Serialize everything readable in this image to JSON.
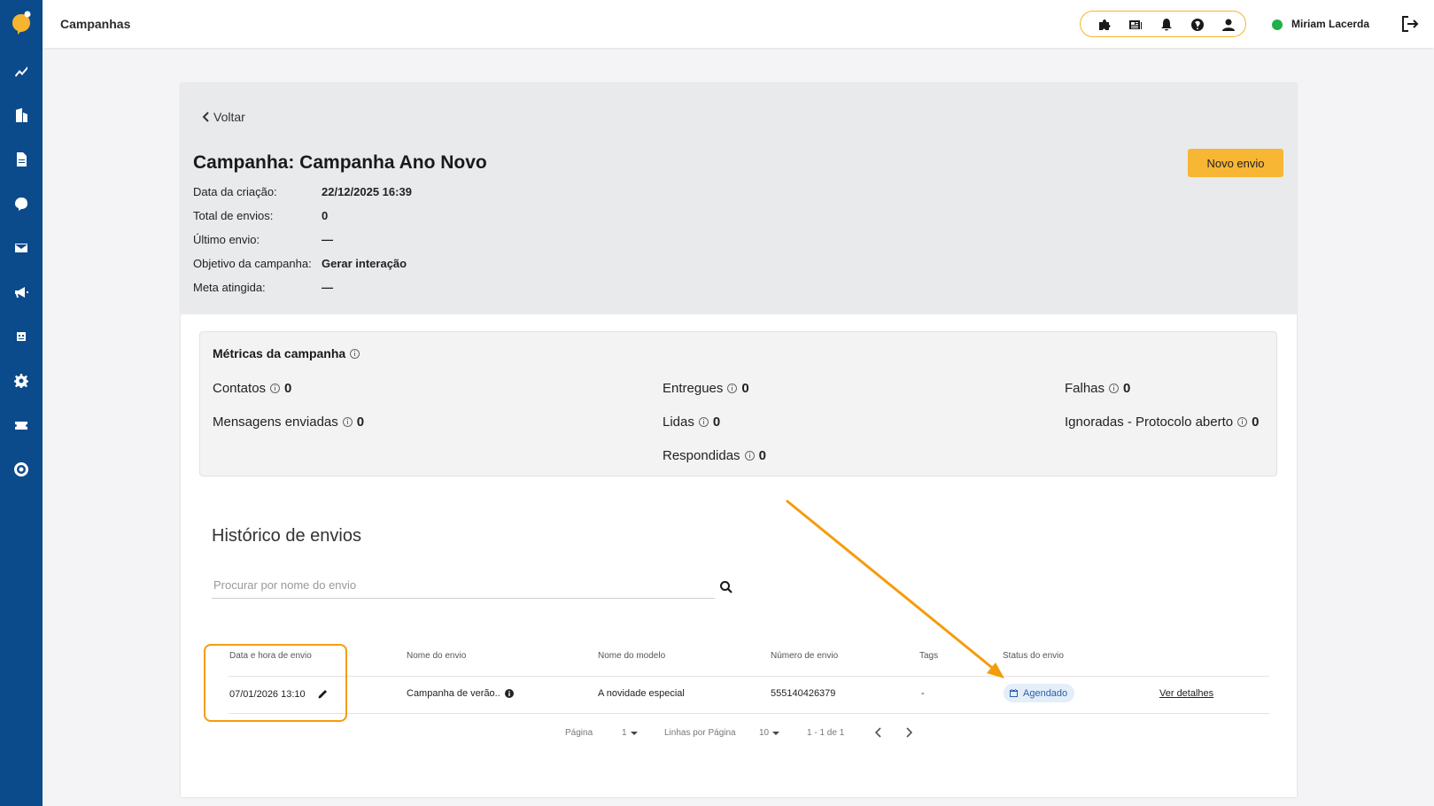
{
  "topbar": {
    "title": "Campanhas",
    "icons": [
      "puzzle-icon",
      "news-icon",
      "bell-icon",
      "help-icon",
      "user-icon"
    ],
    "user_name": "Miriam Lacerda",
    "status_color": "#22b04b"
  },
  "sidebar": {
    "items": [
      "chart-icon",
      "building-icon",
      "document-icon",
      "chat-icon",
      "mail-icon",
      "megaphone-icon",
      "robot-icon",
      "gear-icon",
      "ticket-icon",
      "nps-icon"
    ]
  },
  "campaign": {
    "back_label": "Voltar",
    "title": "Campanha: Campanha Ano Novo",
    "new_button": "Novo envio",
    "info": [
      {
        "label": "Data da criação:",
        "value": "22/12/2025 16:39"
      },
      {
        "label": "Total de envios:",
        "value": "0"
      },
      {
        "label": "Último envio:",
        "value": "—"
      },
      {
        "label": "Objetivo da campanha:",
        "value": "Gerar interação"
      },
      {
        "label": "Meta atingida:",
        "value": "—"
      }
    ]
  },
  "metrics": {
    "title": "Métricas da campanha",
    "items": [
      {
        "label": "Contatos",
        "value": "0"
      },
      {
        "label": "Mensagens enviadas",
        "value": "0"
      },
      {
        "label": "Entregues",
        "value": "0"
      },
      {
        "label": "Lidas",
        "value": "0"
      },
      {
        "label": "Respondidas",
        "value": "0"
      },
      {
        "label": "Falhas",
        "value": "0"
      },
      {
        "label": "Ignoradas - Protocolo aberto",
        "value": "0"
      }
    ]
  },
  "history": {
    "title": "Histórico de envios",
    "search_placeholder": "Procurar por nome do envio",
    "columns": [
      "Data e hora de envio",
      "Nome do envio",
      "Nome do modelo",
      "Número de envio",
      "Tags",
      "Status do envio"
    ],
    "rows": [
      {
        "date": "07/01/2026 13:10",
        "name": "Campanha de verão..",
        "model": "A novidade especial",
        "number": "555140426379",
        "tags": "-",
        "status": "Agendado",
        "action": "Ver detalhes"
      }
    ],
    "pager": {
      "page_label": "Página",
      "page_value": "1",
      "rows_label": "Linhas por Página",
      "rows_value": "10",
      "range": "1 - 1 de 1"
    }
  },
  "colors": {
    "sidebar": "#0b4a8b",
    "accent": "#f7b634",
    "annotation": "#f59c0b"
  }
}
